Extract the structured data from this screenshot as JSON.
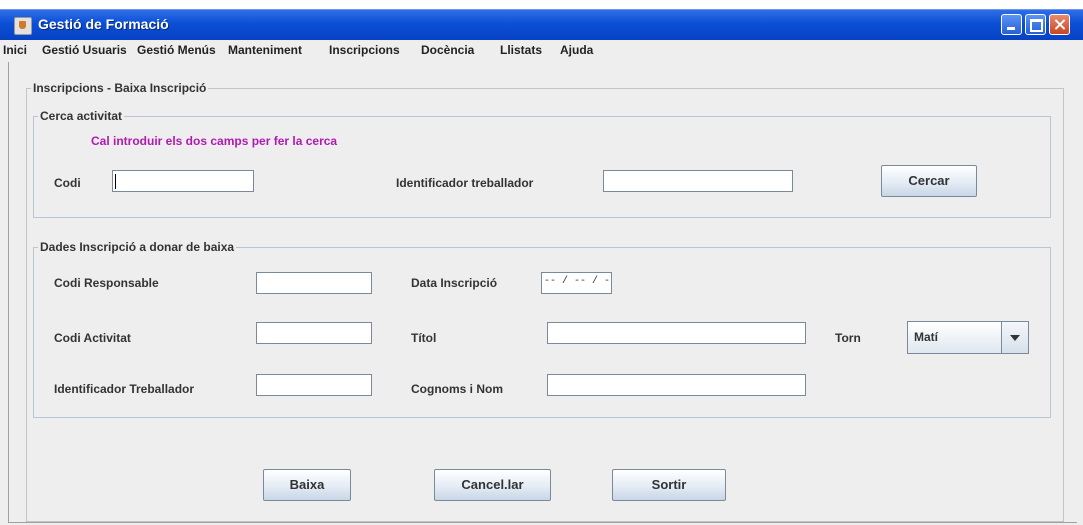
{
  "window": {
    "title": "Gestió de Formació"
  },
  "menu": {
    "items": [
      "Inici",
      "Gestió Usuaris",
      "Gestió Menús",
      "Manteniment",
      "Inscripcions",
      "Docència",
      "Llistats",
      "Ajuda"
    ]
  },
  "main": {
    "panel_title": "Inscripcions - Baixa Inscripció",
    "search": {
      "title": "Cerca activitat",
      "hint": "Cal introduir els dos camps per fer la cerca",
      "codi_label": "Codi",
      "codi_value": "",
      "identificador_label": "Identificador treballador",
      "identificador_value": "",
      "cercar_label": "Cercar"
    },
    "details": {
      "title": "Dades Inscripció a donar de baixa",
      "codi_responsable_label": "Codi Responsable",
      "codi_responsable_value": "",
      "data_inscripcio_label": "Data Inscripció",
      "data_inscripcio_value": "-- / -- / ----",
      "codi_activitat_label": "Codi Activitat",
      "codi_activitat_value": "",
      "titol_label": "Títol",
      "titol_value": "",
      "torn_label": "Torn",
      "torn_value": "Matí",
      "identificador_treballador_label": "Identificador Treballador",
      "identificador_treballador_value": "",
      "cognoms_label": "Cognoms i Nom",
      "cognoms_value": ""
    },
    "buttons": {
      "baixa": "Baixa",
      "cancelar": "Cancel.lar",
      "sortir": "Sortir"
    }
  },
  "colors": {
    "titlebar": "#0a4fd6",
    "hint_text": "#b01ab0",
    "window_bg": "#eeeeee"
  }
}
